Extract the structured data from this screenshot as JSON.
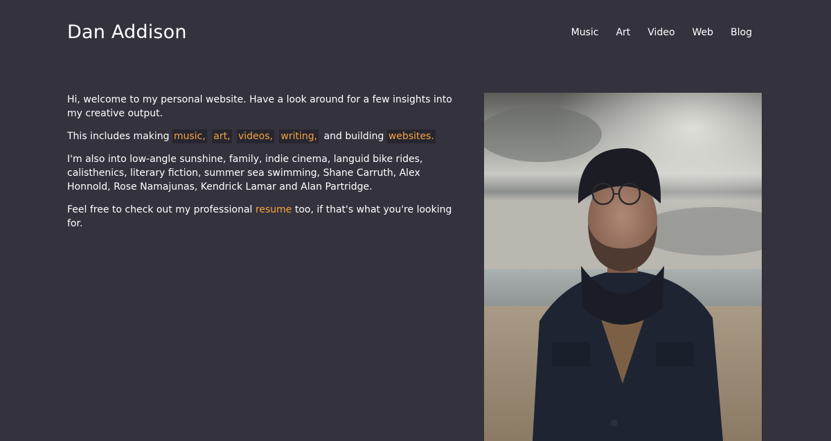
{
  "header": {
    "site_title": "Dan Addison",
    "nav": [
      {
        "label": "Music"
      },
      {
        "label": "Art"
      },
      {
        "label": "Video"
      },
      {
        "label": "Web"
      },
      {
        "label": "Blog"
      }
    ]
  },
  "intro": {
    "p1": "Hi, welcome to my personal website. Have a look around for a few insights into my creative output.",
    "p2_prefix": "This includes making",
    "p2_links": {
      "music": "music,",
      "art": "art,",
      "videos": "videos,",
      "writing": "writing,"
    },
    "p2_middle": "and building",
    "p2_websites": "websites.",
    "p3": "I'm also into low-angle sunshine, family, indie cinema, languid bike rides, calisthenics, literary fiction, summer sea swimming, Shane Carruth, Alex Honnold, Rose Namajunas, Kendrick Lamar and Alan Partridge.",
    "p4_prefix": "Feel free to check out my professional",
    "p4_link": "resume",
    "p4_suffix": "too, if that's what you're looking for."
  },
  "colors": {
    "background": "#33323d",
    "accent": "#f5a442",
    "tag_background": "#272630",
    "text": "#ffffff"
  },
  "photo": {
    "icon": "portrait-photo"
  }
}
